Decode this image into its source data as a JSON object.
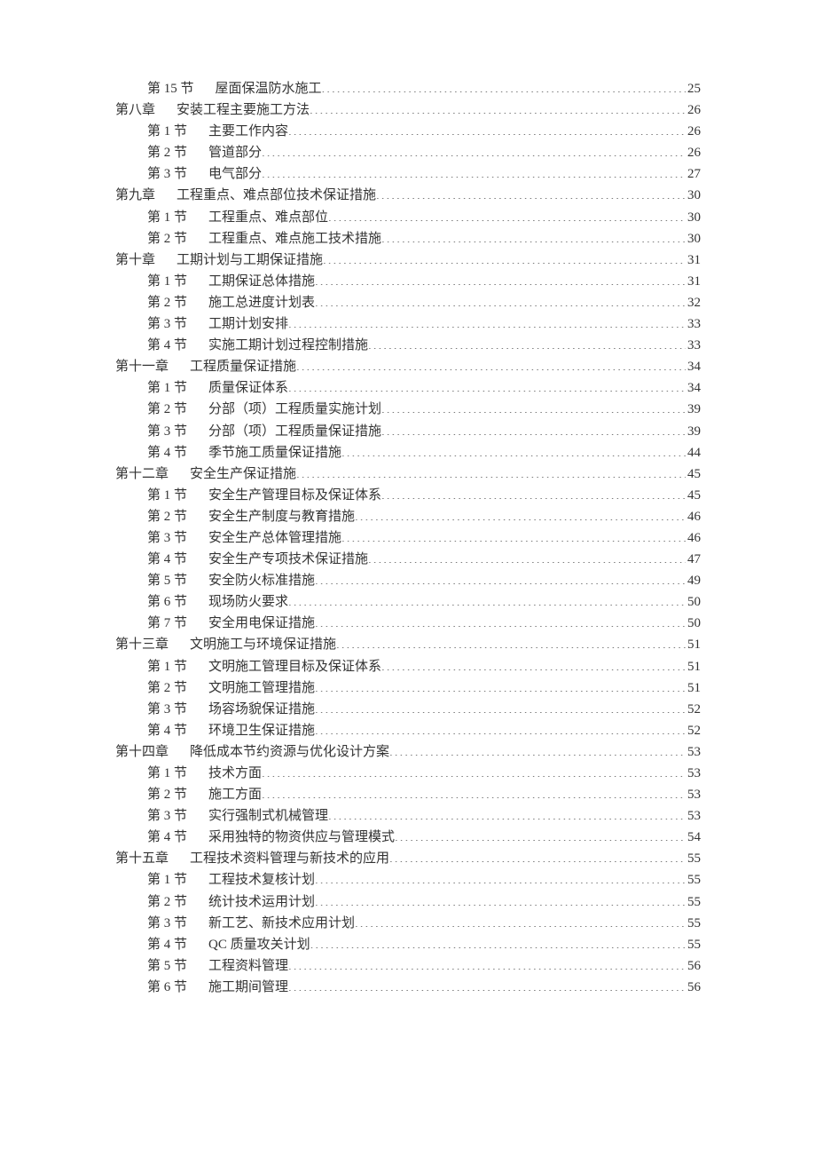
{
  "toc": [
    {
      "level": "section",
      "label": "第 15 节",
      "title": "屋面保温防水施工",
      "page": "25"
    },
    {
      "level": "chapter",
      "label": "第八章",
      "title": "安装工程主要施工方法",
      "page": "26"
    },
    {
      "level": "section",
      "label": "第 1 节",
      "title": "主要工作内容",
      "page": "26"
    },
    {
      "level": "section",
      "label": "第 2 节",
      "title": "管道部分",
      "page": "26"
    },
    {
      "level": "section",
      "label": "第 3 节",
      "title": "电气部分",
      "page": "27"
    },
    {
      "level": "chapter",
      "label": "第九章",
      "title": "工程重点、难点部位技术保证措施",
      "page": "30"
    },
    {
      "level": "section",
      "label": "第 1 节",
      "title": "工程重点、难点部位",
      "page": "30"
    },
    {
      "level": "section",
      "label": "第 2 节",
      "title": "工程重点、难点施工技术措施",
      "page": "30"
    },
    {
      "level": "chapter",
      "label": "第十章",
      "title": "工期计划与工期保证措施",
      "page": "31"
    },
    {
      "level": "section",
      "label": "第 1 节",
      "title": "工期保证总体措施",
      "page": "31"
    },
    {
      "level": "section",
      "label": "第 2 节",
      "title": "施工总进度计划表",
      "page": "32"
    },
    {
      "level": "section",
      "label": "第 3 节",
      "title": "工期计划安排",
      "page": "33"
    },
    {
      "level": "section",
      "label": "第 4 节",
      "title": "实施工期计划过程控制措施",
      "page": "33"
    },
    {
      "level": "chapter",
      "label": "第十一章",
      "title": "工程质量保证措施",
      "page": "34"
    },
    {
      "level": "section",
      "label": "第 1 节",
      "title": "质量保证体系",
      "page": "34"
    },
    {
      "level": "section",
      "label": "第 2 节",
      "title": "分部（项）工程质量实施计划",
      "page": "39"
    },
    {
      "level": "section",
      "label": "第 3 节",
      "title": "分部（项）工程质量保证措施",
      "page": "39"
    },
    {
      "level": "section",
      "label": "第 4 节",
      "title": "季节施工质量保证措施",
      "page": "44"
    },
    {
      "level": "chapter",
      "label": "第十二章",
      "title": "安全生产保证措施",
      "page": "45"
    },
    {
      "level": "section",
      "label": "第 1 节",
      "title": "安全生产管理目标及保证体系",
      "page": "45"
    },
    {
      "level": "section",
      "label": "第 2 节",
      "title": "安全生产制度与教育措施",
      "page": "46"
    },
    {
      "level": "section",
      "label": "第 3 节",
      "title": "安全生产总体管理措施",
      "page": "46"
    },
    {
      "level": "section",
      "label": "第 4 节",
      "title": "安全生产专项技术保证措施",
      "page": "47"
    },
    {
      "level": "section",
      "label": "第 5 节",
      "title": "安全防火标准措施",
      "page": "49"
    },
    {
      "level": "section",
      "label": "第 6 节",
      "title": "现场防火要求",
      "page": "50"
    },
    {
      "level": "section",
      "label": "第 7 节",
      "title": "安全用电保证措施",
      "page": "50"
    },
    {
      "level": "chapter",
      "label": "第十三章",
      "title": "文明施工与环境保证措施",
      "page": "51"
    },
    {
      "level": "section",
      "label": "第 1 节",
      "title": "文明施工管理目标及保证体系",
      "page": "51"
    },
    {
      "level": "section",
      "label": "第 2 节",
      "title": "文明施工管理措施",
      "page": "51"
    },
    {
      "level": "section",
      "label": "第 3 节",
      "title": "场容场貌保证措施",
      "page": "52"
    },
    {
      "level": "section",
      "label": "第 4 节",
      "title": "环境卫生保证措施",
      "page": "52"
    },
    {
      "level": "chapter",
      "label": "第十四章",
      "title": "降低成本节约资源与优化设计方案",
      "page": "53"
    },
    {
      "level": "section",
      "label": "第 1 节",
      "title": "技术方面",
      "page": "53"
    },
    {
      "level": "section",
      "label": "第 2 节",
      "title": "施工方面",
      "page": "53"
    },
    {
      "level": "section",
      "label": "第 3 节",
      "title": "实行强制式机械管理",
      "page": "53"
    },
    {
      "level": "section",
      "label": "第 4 节",
      "title": "采用独特的物资供应与管理模式",
      "page": "54"
    },
    {
      "level": "chapter",
      "label": "第十五章",
      "title": "工程技术资料管理与新技术的应用",
      "page": "55"
    },
    {
      "level": "section",
      "label": "第 1 节",
      "title": "工程技术复核计划",
      "page": "55"
    },
    {
      "level": "section",
      "label": "第 2 节",
      "title": "统计技术运用计划",
      "page": "55"
    },
    {
      "level": "section",
      "label": "第 3 节",
      "title": "新工艺、新技术应用计划",
      "page": "55"
    },
    {
      "level": "section",
      "label": "第 4 节",
      "title": "QC 质量攻关计划",
      "page": "55"
    },
    {
      "level": "section",
      "label": "第 5 节",
      "title": "工程资料管理",
      "page": "56"
    },
    {
      "level": "section",
      "label": "第 6 节",
      "title": "施工期间管理",
      "page": "56"
    }
  ]
}
